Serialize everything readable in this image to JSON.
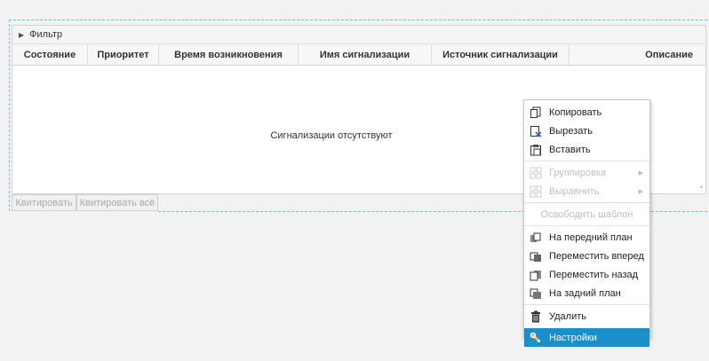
{
  "filter": {
    "label": "Фильтр"
  },
  "table": {
    "columns": [
      "Состояние",
      "Приоритет",
      "Время возникновения",
      "Имя сигнализации",
      "Источник сигнализации",
      "Описание"
    ],
    "empty_text": "Сигнализации отсутствуют"
  },
  "buttons": {
    "ack": "Квитировать",
    "ack_all": "Квитировать всё"
  },
  "context_menu": {
    "copy": "Копировать",
    "cut": "Вырезать",
    "paste": "Вставить",
    "group": "Группировка",
    "align": "Выравнить",
    "free_template": "Освободить шаблон",
    "bring_front": "На передний план",
    "move_forward": "Переместить вперед",
    "move_back": "Переместить назад",
    "send_back": "На задний план",
    "delete": "Удалить",
    "settings": "Настройки"
  },
  "colors": {
    "accent": "#1b8fc9",
    "dash": "#7fb7e6"
  }
}
